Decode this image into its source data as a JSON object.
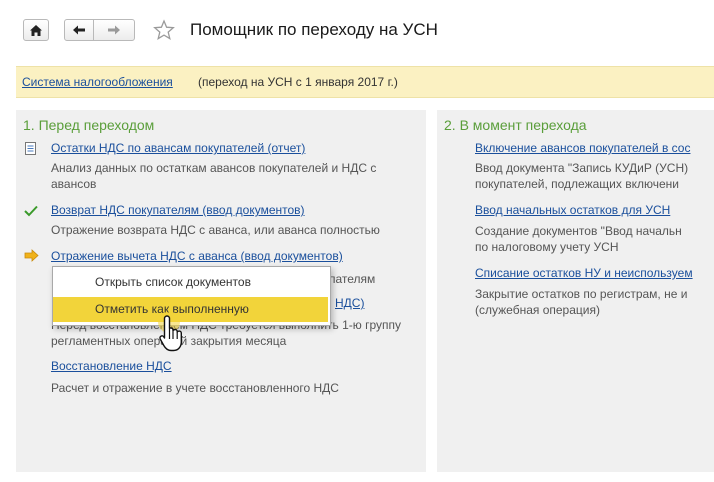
{
  "window": {
    "title": "Помощник по переходу на УСН",
    "nav": {
      "home_icon": "home-icon",
      "back_icon": "arrow-left-icon",
      "forward_icon": "arrow-right-icon",
      "favorite_icon": "star-icon"
    }
  },
  "info": {
    "link": "Система налогообложения",
    "text": "(переход на УСН с 1 января 2017 г.)"
  },
  "left": {
    "title": "1. Перед переходом",
    "items": [
      {
        "status": "doc",
        "link": "Остатки НДС по авансам покупателей (отчет)",
        "desc": [
          "Анализ данных по остаткам авансов покупателей и НДС с",
          "авансов"
        ]
      },
      {
        "status": "done",
        "link": "Возврат НДС покупателям (ввод документов)",
        "desc": [
          "Отражение возврата НДС с аванса, или аванса полностью"
        ]
      },
      {
        "status": "current",
        "link": "Отражение вычета НДС с аванса (ввод документов)",
        "desc_fragment": "пателям"
      },
      {
        "status": "pending",
        "link_fragment": "НДС)",
        "desc": [
          "Перед восстановлением НДС требуется выполнить 1-ю группу",
          "регламентных операций закрытия месяца"
        ]
      },
      {
        "status": "pending",
        "link": "Восстановление НДС",
        "desc": [
          "Расчет и отражение в учете восстановленного НДС"
        ]
      }
    ]
  },
  "right": {
    "title": "2. В момент перехода",
    "items": [
      {
        "link": "Включение авансов покупателей в сос",
        "desc": [
          "Ввод документа \"Запись КУДиР (УСН)",
          "покупателей, подлежащих включени"
        ]
      },
      {
        "link": "Ввод начальных остатков для УСН",
        "desc": [
          "Создание документов \"Ввод начальн",
          "по налоговому учету УСН"
        ]
      },
      {
        "link": "Списание остатков НУ и неиспользуем",
        "desc": [
          "Закрытие остатков по  регистрам, не и",
          "(служебная операция)"
        ]
      }
    ]
  },
  "context_menu": {
    "items": [
      "Открыть список документов",
      "Отметить как выполненную"
    ],
    "highlighted_index": 1
  },
  "colors": {
    "accent_green": "#5a9e3a",
    "link_blue": "#1a4f9c",
    "info_bg": "#fbf1c2",
    "highlight": "#f2d43a"
  }
}
